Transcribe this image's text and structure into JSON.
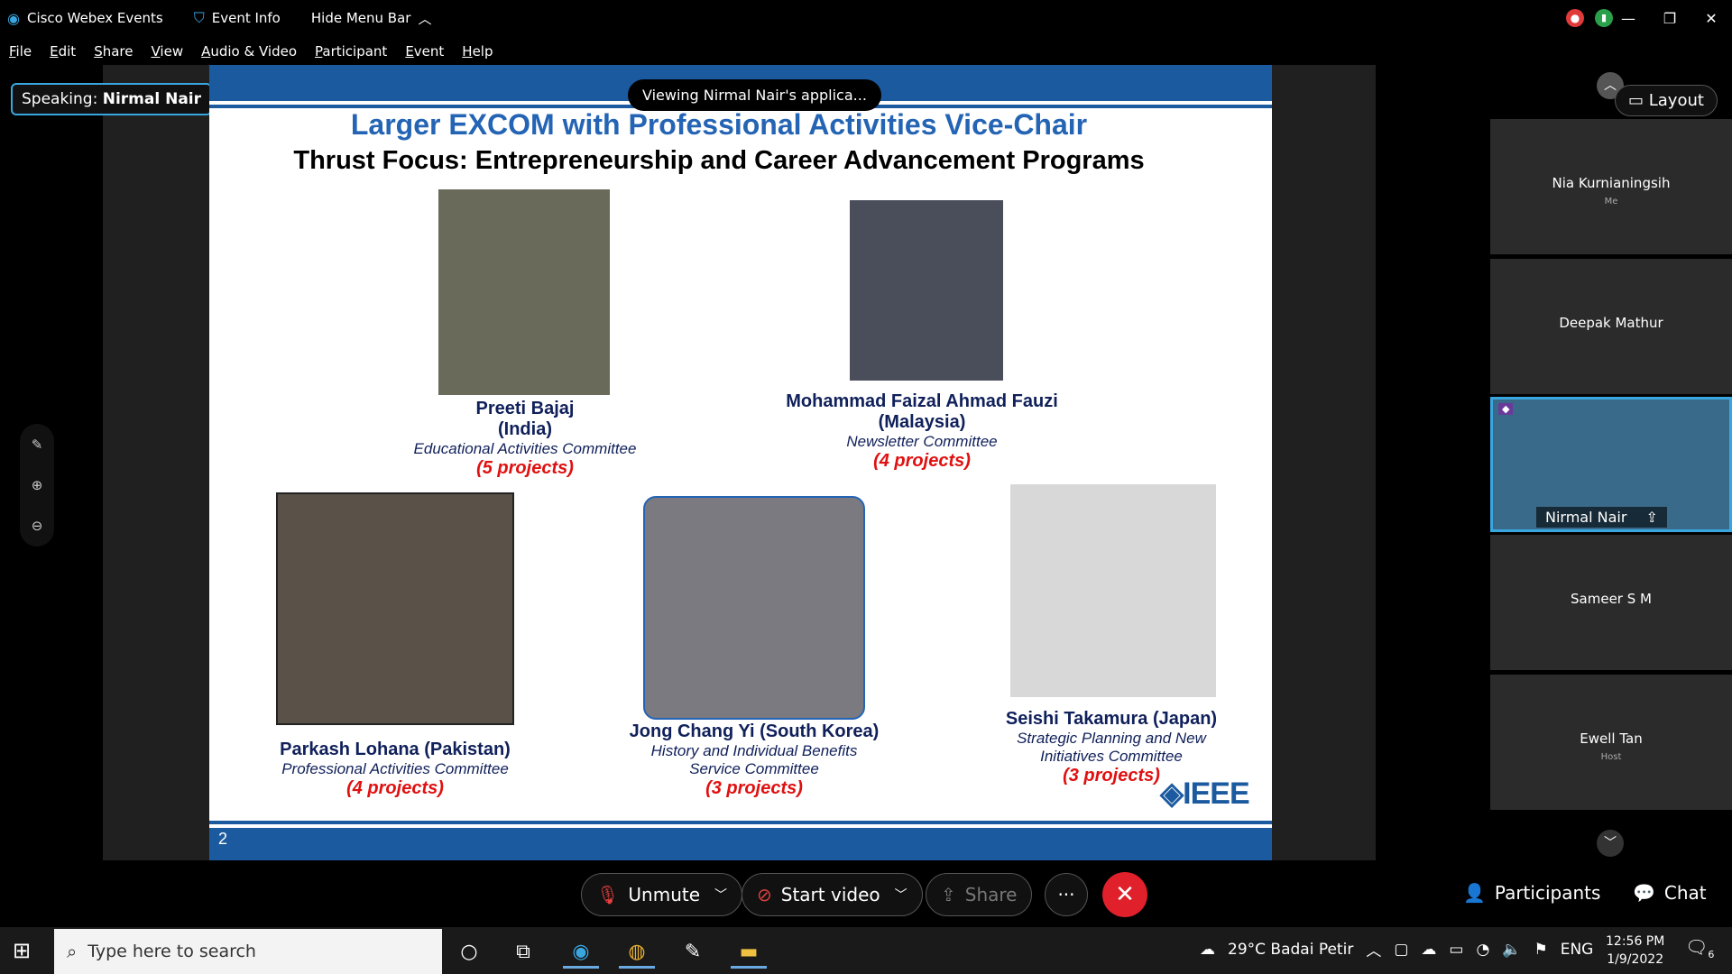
{
  "titlebar": {
    "app_name": "Cisco Webex Events",
    "event_info": "Event Info",
    "hide_menu": "Hide Menu Bar"
  },
  "menu": {
    "items": [
      "File",
      "Edit",
      "Share",
      "View",
      "Audio & Video",
      "Participant",
      "Event",
      "Help"
    ]
  },
  "speaking": {
    "prefix": "Speaking:",
    "name": "Nirmal Nair"
  },
  "viewing_pill": "Viewing Nirmal Nair's applica...",
  "slide": {
    "title": "Larger EXCOM with Professional Activities Vice-Chair",
    "subtitle": "Thrust Focus:  Entrepreneurship and Career Advancement  Programs",
    "number": "2",
    "logo_text": "IEEE",
    "people": [
      {
        "name": "Preeti Bajaj",
        "country": "(India)",
        "committee": "Educational Activities  Committee",
        "projects": "(5 projects)"
      },
      {
        "name": "Mohammad Faizal Ahmad Fauzi",
        "country": "(Malaysia)",
        "committee": "Newsletter Committee",
        "projects": "(4 projects)"
      },
      {
        "name": "Parkash Lohana (Pakistan)",
        "committee": "Professional Activities  Committee",
        "projects": "(4 projects)"
      },
      {
        "name": "Jong Chang Yi (South Korea)",
        "committee_line1": "History and Individual Benefits",
        "committee_line2": "Service Committee",
        "projects": "(3 projects)"
      },
      {
        "name": "Seishi Takamura (Japan)",
        "committee_line1": "Strategic Planning and New",
        "committee_line2": "Initiatives Committee",
        "projects": "(3 projects)"
      }
    ]
  },
  "right_panel": {
    "layout_label": "Layout",
    "participants": [
      {
        "name": "Nia Kurnianingsih",
        "role": "Me"
      },
      {
        "name": "Deepak Mathur",
        "role": ""
      },
      {
        "name": "Nirmal Nair",
        "role": ""
      },
      {
        "name": "Sameer S M",
        "role": ""
      },
      {
        "name": "Ewell Tan",
        "role": "Host"
      }
    ]
  },
  "controls": {
    "unmute": "Unmute",
    "start_video": "Start video",
    "share": "Share",
    "more": "···",
    "participants": "Participants",
    "chat": "Chat"
  },
  "taskbar": {
    "search_placeholder": "Type here to search",
    "weather": "29°C  Badai Petir",
    "language": "ENG",
    "time": "12:56 PM",
    "date": "1/9/2022",
    "notifications": "6"
  },
  "colors": {
    "accent_blue": "#3aa6e0",
    "slide_blue": "#1c5aa0",
    "leave_red": "#e0202a",
    "project_red": "#e01010"
  }
}
